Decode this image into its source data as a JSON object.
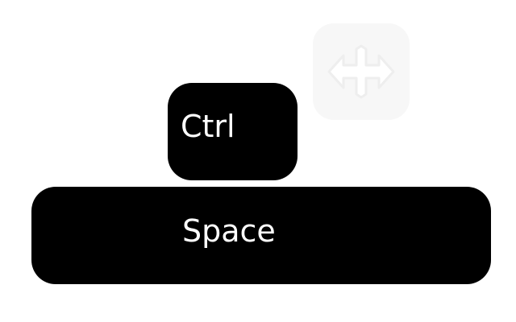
{
  "keys": {
    "ctrl_label": "Ctrl",
    "space_label": "Space"
  },
  "icons": {
    "arrow_key_icon": "left-right-arrow-icon"
  },
  "colors": {
    "key_background": "#000000",
    "key_text": "#ffffff",
    "faded_key_background": "#f7f7f7",
    "faded_arrow": "#eeeeee",
    "page_background": "#ffffff"
  }
}
